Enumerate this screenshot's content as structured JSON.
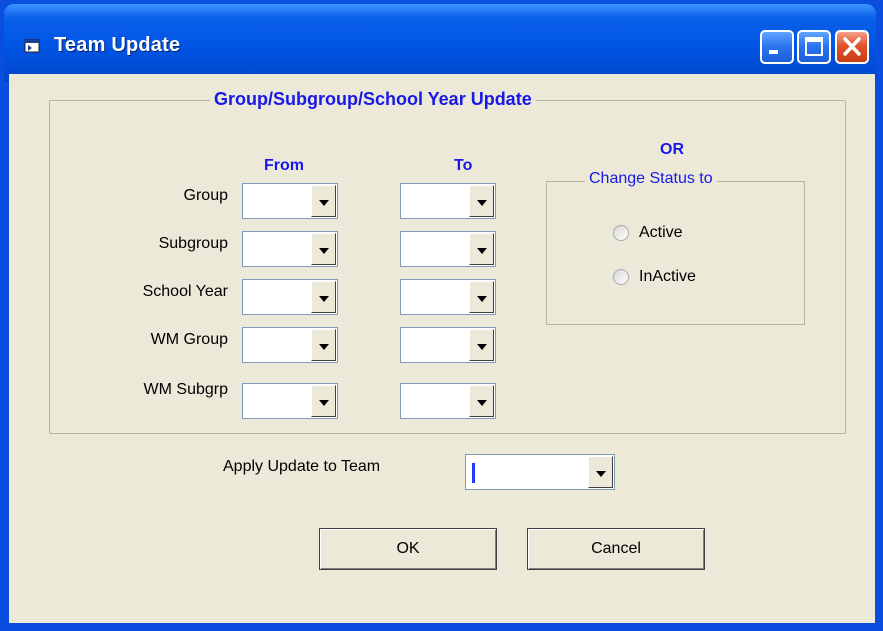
{
  "window": {
    "title": "Team Update"
  },
  "group_box": {
    "title": "Group/Subgroup/School Year Update"
  },
  "columns": {
    "from": "From",
    "to": "To"
  },
  "rows": [
    {
      "label": "Group",
      "from_value": "",
      "to_value": ""
    },
    {
      "label": "Subgroup",
      "from_value": "",
      "to_value": ""
    },
    {
      "label": "School Year",
      "from_value": "",
      "to_value": ""
    },
    {
      "label": "WM Group",
      "from_value": "",
      "to_value": ""
    },
    {
      "label": "WM Subgrp",
      "from_value": "",
      "to_value": ""
    }
  ],
  "status": {
    "or_label": "OR",
    "title": "Change Status to",
    "options": [
      {
        "label": "Active",
        "selected": false
      },
      {
        "label": "InActive",
        "selected": false
      }
    ]
  },
  "apply": {
    "label": "Apply Update to Team",
    "value": ""
  },
  "buttons": {
    "ok": "OK",
    "cancel": "Cancel"
  },
  "icons": {
    "window": "window-icon",
    "minimize": "minimize-icon",
    "maximize": "maximize-icon",
    "close": "close-icon"
  },
  "colors": {
    "titlebar": "#0055e5",
    "dialog_bg": "#ece9d8",
    "accent_text": "#1818e8",
    "close": "#e2532c"
  }
}
